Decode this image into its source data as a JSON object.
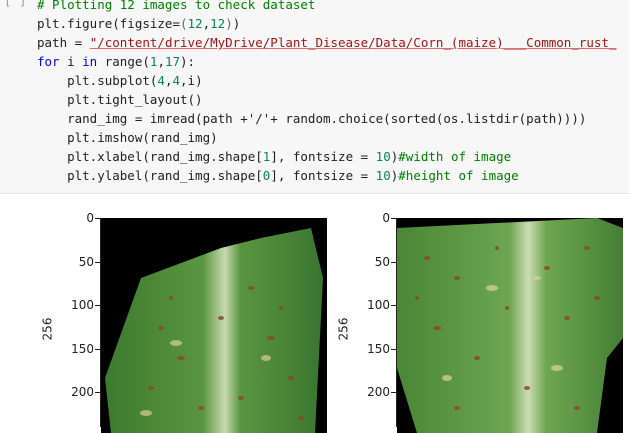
{
  "cell": {
    "prompt": "[ ]",
    "lines": [
      {
        "parts": [
          [
            "cm",
            "# Plotting 12 images to check dataset"
          ]
        ]
      },
      {
        "parts": [
          [
            "",
            "plt.figure(figsize="
          ],
          [
            "op",
            "("
          ],
          [
            "num",
            "12"
          ],
          [
            "",
            ","
          ],
          [
            "num",
            "12"
          ],
          [
            "op",
            ")"
          ],
          [
            "",
            ")"
          ]
        ]
      },
      {
        "parts": [
          [
            "",
            "path = "
          ],
          [
            "str",
            "\"/content/drive/MyDrive/Plant_Disease/Data/Corn_(maize)___Common_rust_"
          ]
        ]
      },
      {
        "parts": [
          [
            "kw",
            "for"
          ],
          [
            "",
            " i "
          ],
          [
            "kw",
            "in"
          ],
          [
            "",
            " range("
          ],
          [
            "num",
            "1"
          ],
          [
            "",
            ","
          ],
          [
            "num",
            "17"
          ],
          [
            "",
            "):"
          ]
        ]
      },
      {
        "parts": [
          [
            "",
            "    plt.subplot("
          ],
          [
            "num",
            "4"
          ],
          [
            "",
            ","
          ],
          [
            "num",
            "4"
          ],
          [
            "",
            ",i)"
          ]
        ]
      },
      {
        "parts": [
          [
            "",
            "    plt.tight_layout()"
          ]
        ]
      },
      {
        "parts": [
          [
            "",
            "    rand_img = imread(path +'/'+ random.choice(sorted(os.listdir(path))))"
          ]
        ]
      },
      {
        "parts": [
          [
            "",
            "    plt.imshow(rand_img)"
          ]
        ]
      },
      {
        "parts": [
          [
            "",
            "    plt.xlabel(rand_img.shape["
          ],
          [
            "num",
            "1"
          ],
          [
            "",
            "], fontsize = "
          ],
          [
            "num",
            "10"
          ],
          [
            "",
            ")"
          ],
          [
            "cm",
            "#width of image"
          ]
        ]
      },
      {
        "parts": [
          [
            "",
            "    plt.ylabel(rand_img.shape["
          ],
          [
            "num",
            "0"
          ],
          [
            "",
            "], fontsize = "
          ],
          [
            "num",
            "10"
          ],
          [
            "",
            ")"
          ],
          [
            "cm",
            "#height of image"
          ]
        ]
      }
    ]
  },
  "output": {
    "subplots": [
      {
        "ylabel": "256",
        "yticks": [
          "0",
          "50",
          "100",
          "150",
          "200"
        ]
      },
      {
        "ylabel": "256",
        "yticks": [
          "0",
          "50",
          "100",
          "150",
          "200"
        ]
      }
    ]
  },
  "colors": {
    "leaf_green": "#4f8a3a",
    "leaf_dark": "#2f6a2a",
    "rust_spot": "#8a4a2a"
  }
}
